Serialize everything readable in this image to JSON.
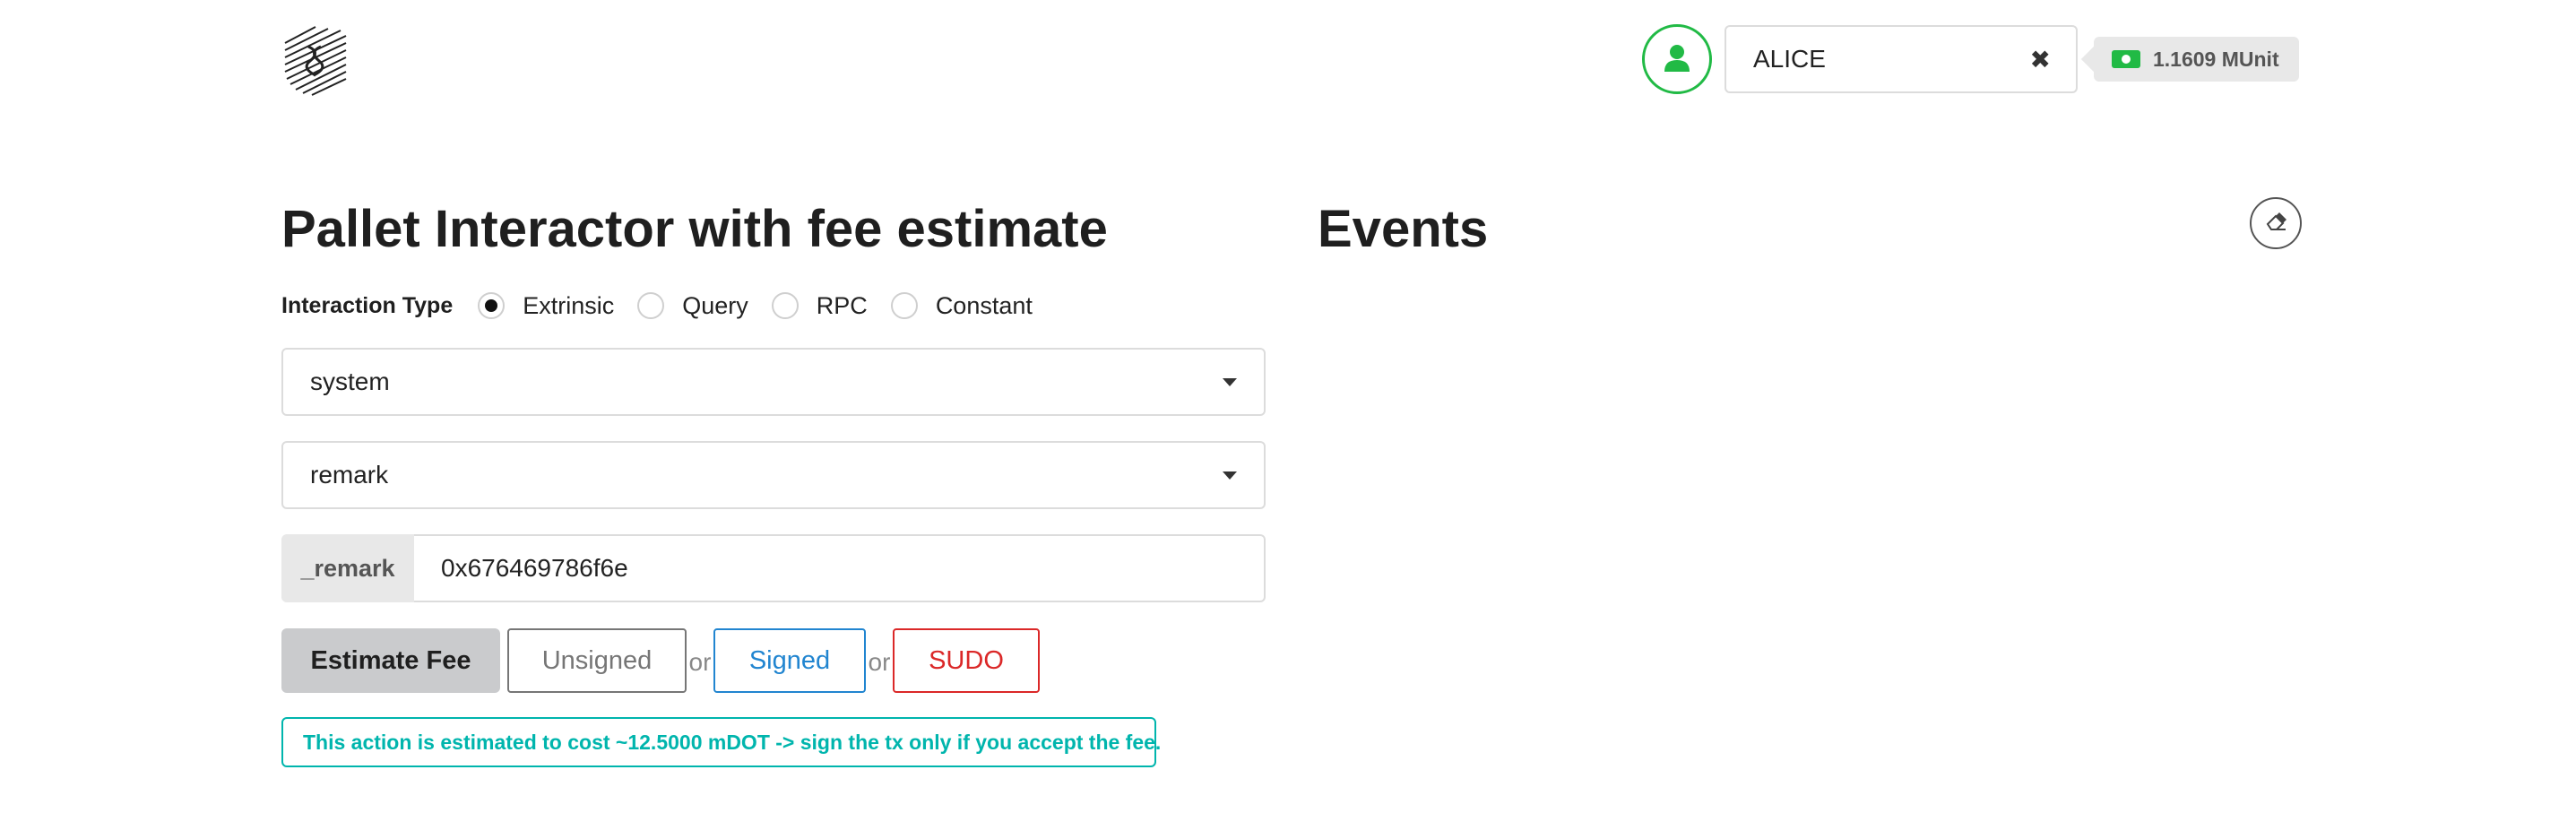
{
  "header": {
    "account": {
      "name": "ALICE",
      "clear_glyph": "✖"
    },
    "balance": {
      "value": "1.1609 MUnit"
    },
    "icons": {
      "logo": "substrate-logo-icon",
      "avatar": "user-icon",
      "money": "money-icon",
      "clear": "close-icon"
    },
    "colors": {
      "avatar_border": "#21ba45",
      "money": "#21ba45"
    }
  },
  "interactor": {
    "title": "Pallet Interactor with fee estimate",
    "interaction_type_label": "Interaction Type",
    "interaction_types": [
      {
        "label": "Extrinsic",
        "checked": true
      },
      {
        "label": "Query",
        "checked": false
      },
      {
        "label": "RPC",
        "checked": false
      },
      {
        "label": "Constant",
        "checked": false
      }
    ],
    "pallet": "system",
    "callable": "remark",
    "param": {
      "label": "_remark",
      "value": "0x676469786f6e"
    },
    "buttons": {
      "estimate": "Estimate Fee",
      "unsigned": "Unsigned",
      "or1": "or",
      "signed": "Signed",
      "or2": "or",
      "sudo": "SUDO"
    },
    "fee_message": "This action is estimated to cost ~12.5000 mDOT -> sign the tx only if you accept the fee.",
    "colors": {
      "estimate_bg": "#cacbcd",
      "unsigned": "#767676",
      "signed": "#2185d0",
      "sudo": "#db2828",
      "fee_message": "#00b5ad"
    }
  },
  "events": {
    "title": "Events",
    "clear_icon": "eraser-icon"
  }
}
